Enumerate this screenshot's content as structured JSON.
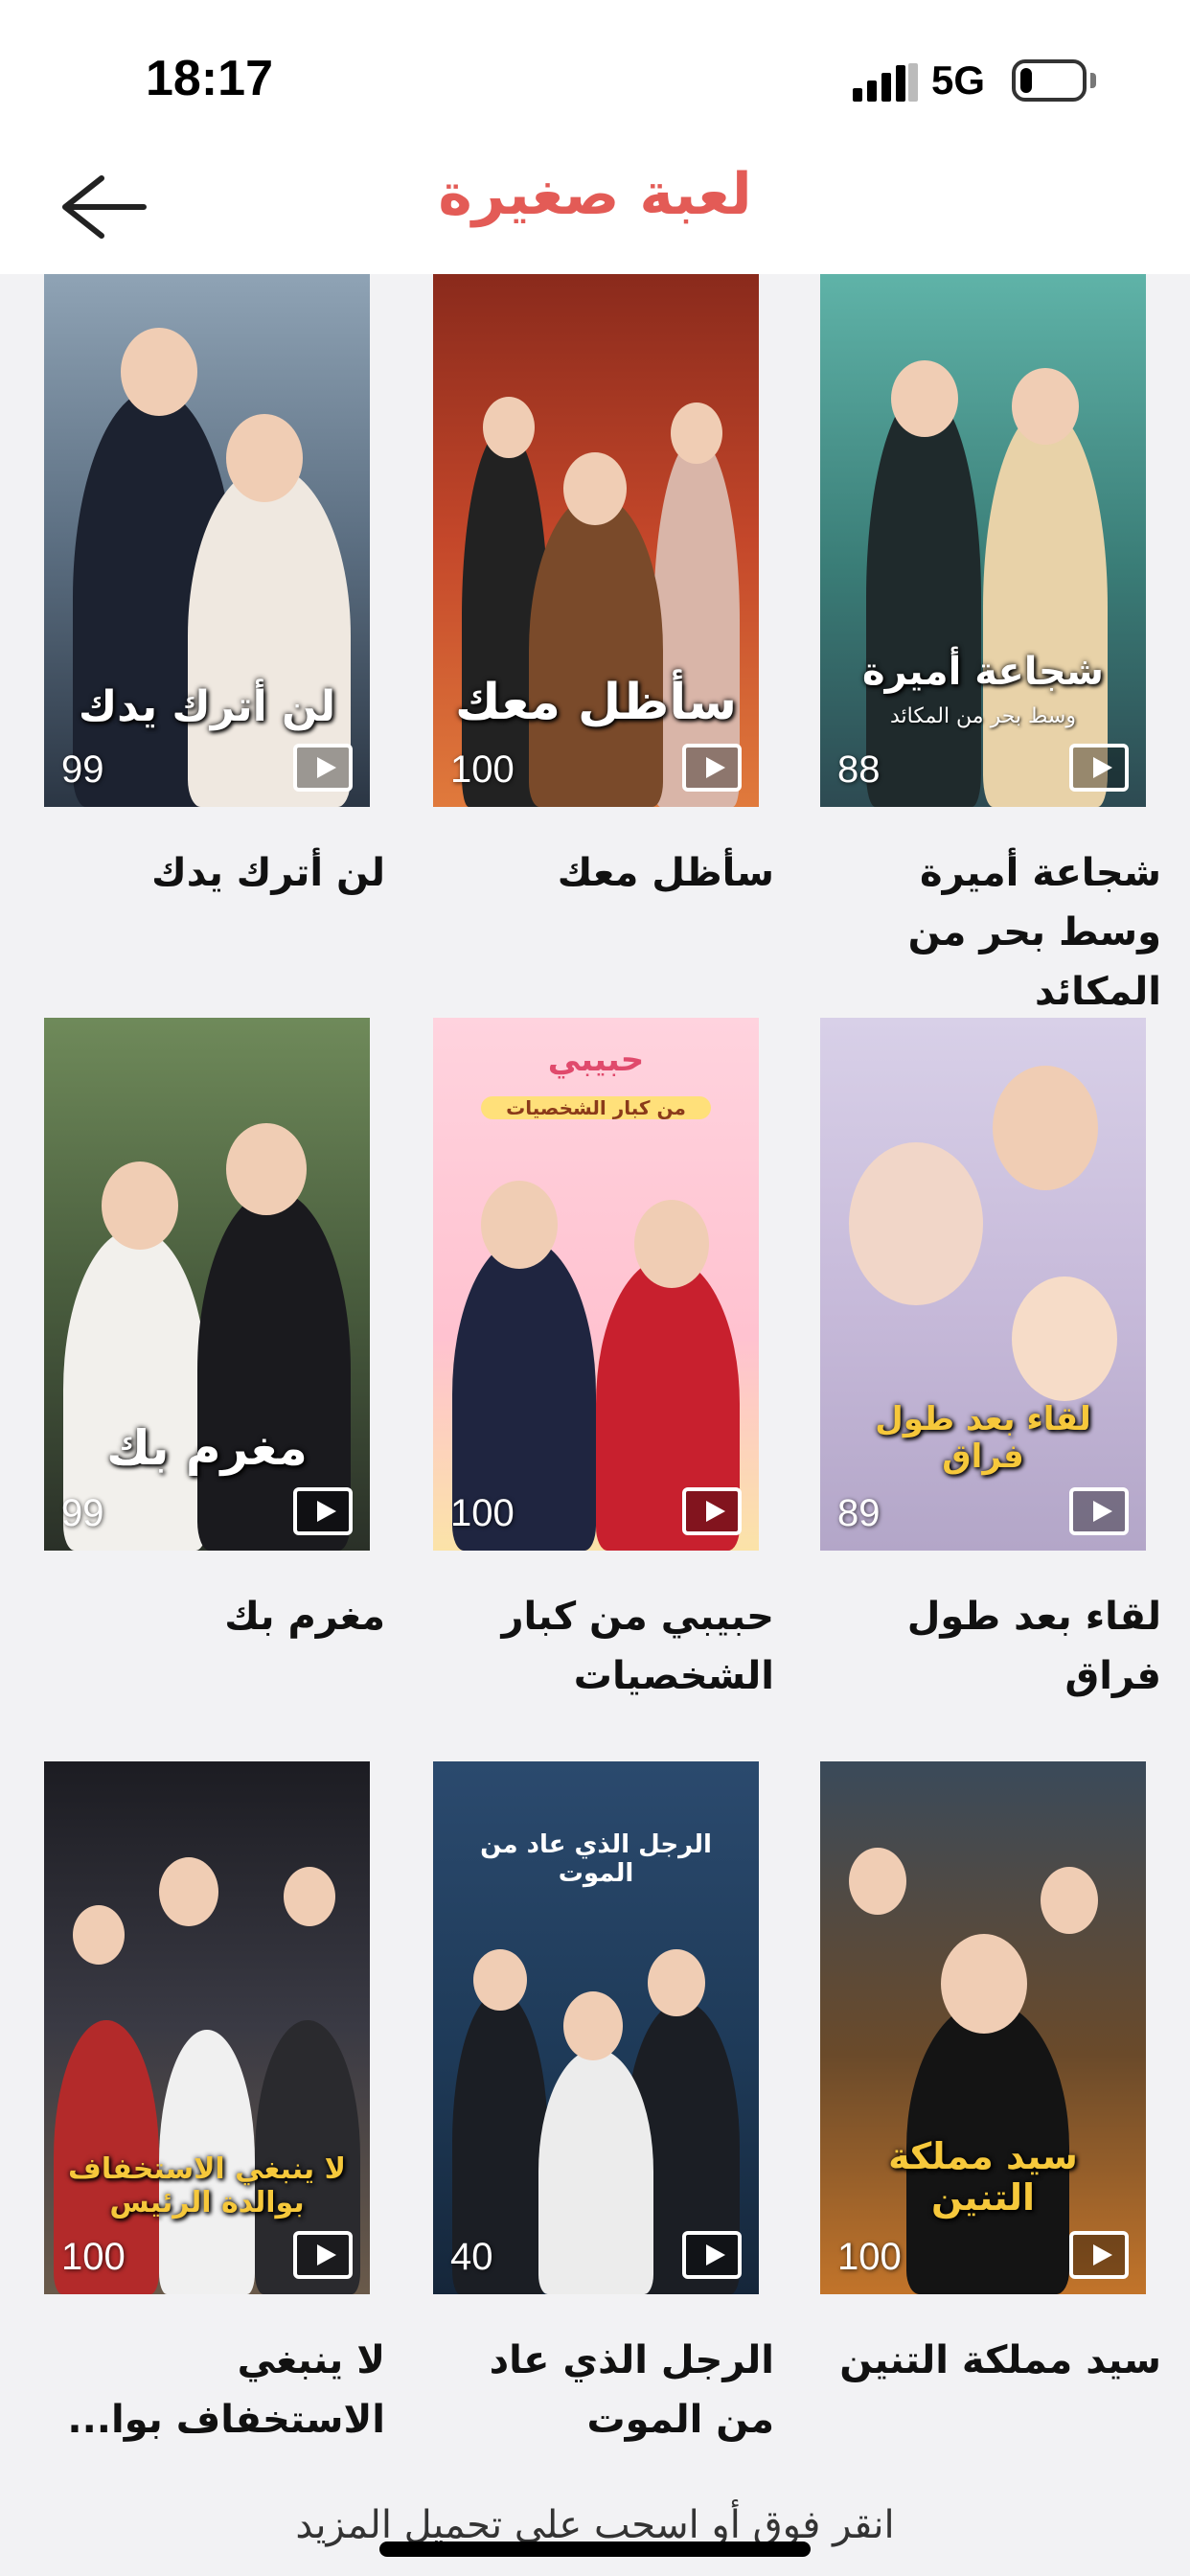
{
  "status_bar": {
    "time": "18:17",
    "network": "5G",
    "battery_level": 0.2,
    "icons": [
      "signal-icon",
      "battery-icon"
    ]
  },
  "nav": {
    "title": "لعبة صغيرة",
    "back_icon": "arrow-left-icon"
  },
  "dramas": [
    {
      "title": "شجاعة أميرة وسط بحر من المكائد",
      "poster_title": "شجاعة أميرة",
      "poster_subtitle": "وسط بحر من المكائد",
      "episodes": "88"
    },
    {
      "title": "سأظل معك",
      "poster_title": "سأظل معك",
      "episodes": "100"
    },
    {
      "title": "لن أترك يدك",
      "poster_title": "لن أترك يدك",
      "episodes": "99"
    },
    {
      "title": "لقاء بعد طول فراق",
      "poster_title": "لقاء بعد طول فراق",
      "episodes": "89"
    },
    {
      "title": "حبيبي من كبار الشخصيات",
      "poster_title": "حبيبي",
      "poster_subtitle": "من كبار الشخصيات",
      "episodes": "100"
    },
    {
      "title": "مغرم بك",
      "poster_title": "مغرم بك",
      "episodes": "99"
    },
    {
      "title": "سيد مملكة التنين",
      "poster_title": "سيد مملكة التنين",
      "episodes": "100"
    },
    {
      "title": "الرجل الذي عاد من الموت",
      "poster_title": "الرجل الذي عاد من الموت",
      "episodes": "40"
    },
    {
      "title": "لا ينبغي الاستخفاف بوا...",
      "poster_title": "لا ينبغي الاستخفاف بوالدة الرئيس",
      "episodes": "100"
    }
  ],
  "footer": {
    "hint": "انقر فوق أو اسحب على تحميل المزيد"
  },
  "colors": {
    "accent": "#e35b56",
    "background": "#f2f2f4"
  }
}
